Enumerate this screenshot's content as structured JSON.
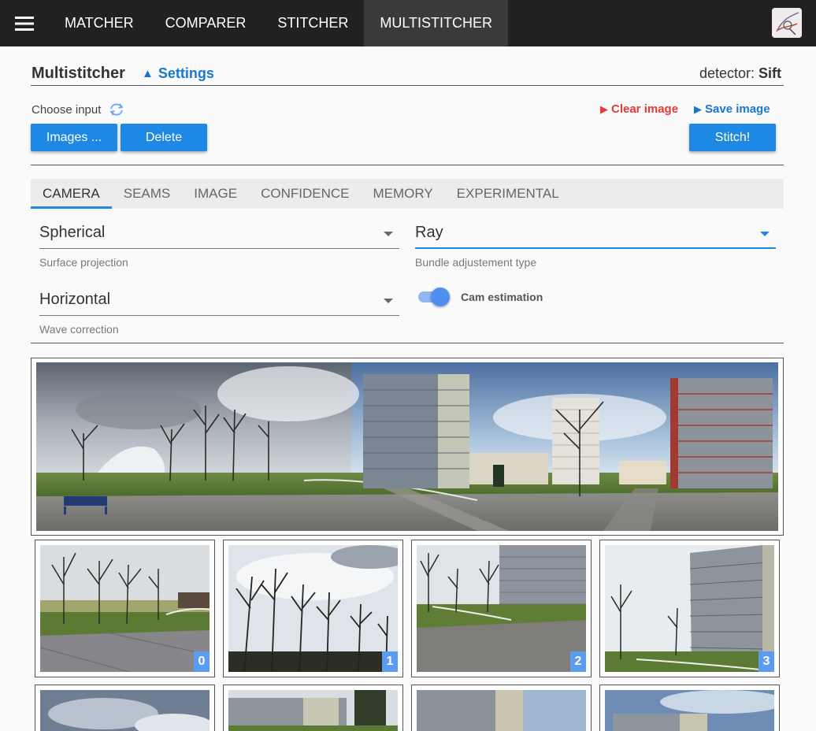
{
  "nav": {
    "tabs": [
      {
        "label": "MATCHER"
      },
      {
        "label": "COMPARER"
      },
      {
        "label": "STITCHER"
      },
      {
        "label": "MULTISTITCHER"
      }
    ]
  },
  "header": {
    "title": "Multistitcher",
    "settings_label": "Settings",
    "detector_label": "detector:",
    "detector_value": "Sift"
  },
  "input": {
    "choose_label": "Choose input",
    "images_button": "Images ...",
    "delete_button": "Delete",
    "clear_image": "Clear image",
    "save_image": "Save image",
    "stitch_button": "Stitch!"
  },
  "tabs": [
    {
      "label": "CAMERA"
    },
    {
      "label": "SEAMS"
    },
    {
      "label": "IMAGE"
    },
    {
      "label": "CONFIDENCE"
    },
    {
      "label": "MEMORY"
    },
    {
      "label": "EXPERIMENTAL"
    }
  ],
  "camera": {
    "surface_projection": {
      "value": "Spherical",
      "hint": "Surface projection"
    },
    "bundle_adjustment": {
      "value": "Ray",
      "hint": "Bundle adjustement type"
    },
    "wave_correction": {
      "value": "Horizontal",
      "hint": "Wave correction"
    },
    "cam_estimation": {
      "label": "Cam estimation",
      "enabled": true
    }
  },
  "thumbnails": [
    {
      "index": "0"
    },
    {
      "index": "1"
    },
    {
      "index": "2"
    },
    {
      "index": "3"
    }
  ],
  "colors": {
    "accent": "#1e88e5",
    "clear": "#e53935",
    "topbar": "#212121"
  }
}
